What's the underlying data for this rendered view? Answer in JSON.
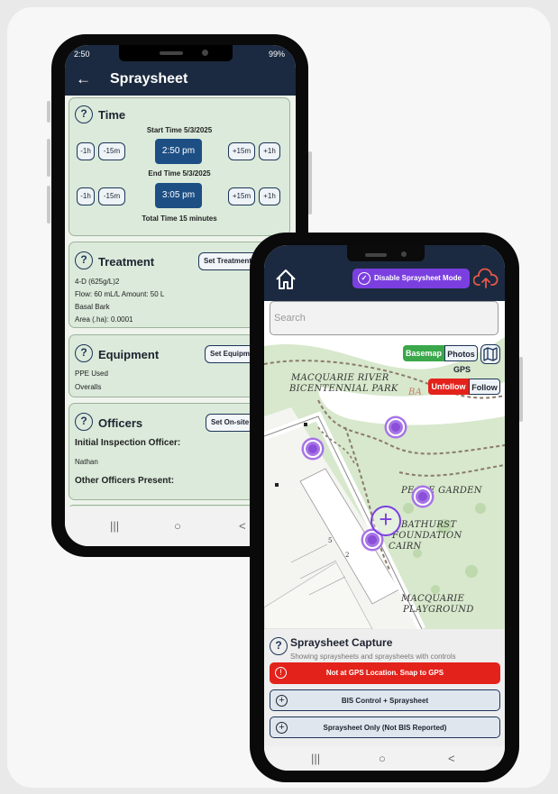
{
  "back_phone": {
    "status": {
      "time": "2:50",
      "battery": "99%"
    },
    "title": "Spraysheet",
    "time_section": {
      "title": "Time",
      "start_label": "Start Time 5/3/2025",
      "end_label": "End Time 5/3/2025",
      "start_value": "2:50 pm",
      "end_value": "3:05 pm",
      "total": "Total Time 15 minutes",
      "minus_1h": "-1h",
      "minus_15m": "-15m",
      "plus_15m": "+15m",
      "plus_1h": "+1h"
    },
    "treatment": {
      "title": "Treatment",
      "button": "Set Treatment",
      "lines": [
        "4-D (625g/L)2",
        "Flow: 60 mL/L  Amount: 50 L",
        "Basal Bark",
        "Area (.ha): 0.0001"
      ]
    },
    "equipment": {
      "title": "Equipment",
      "button": "Set Equipment",
      "lines": [
        "PPE Used",
        "Overalls"
      ]
    },
    "officers": {
      "title": "Officers",
      "button": "Set On-site",
      "initial_label": "Initial Inspection Officer:",
      "initial_value": "Nathan",
      "other_label": "Other Officers Present:"
    },
    "nav": {
      "recent": "|||",
      "home": "○",
      "back": "<"
    }
  },
  "front_phone": {
    "disable_button": "Disable Spraysheet Mode",
    "search_placeholder": "Search",
    "basemap": "Basemap",
    "photos": "Photos",
    "gps_label": "GPS",
    "unfollow": "Unfollow",
    "follow": "Follow",
    "map_labels": {
      "park1": "MACQUARIE RIVER",
      "park2": "BICENTENNIAL PARK",
      "bay": "BA",
      "peace": "PEACE GARDEN",
      "bathurst1": "BATHURST",
      "bathurst2": "FOUNDATION",
      "bathurst3": "CAIRN",
      "play1": "MACQUARIE",
      "play2": "PLAYGROUND",
      "street1": "5",
      "street2": "2"
    },
    "capture": {
      "title": "Spraysheet Capture",
      "subtitle": "Showing spraysheets and spraysheets with controls",
      "alert": "Not at GPS Location. Snap to GPS",
      "option1": "BIS Control + Spraysheet",
      "option2": "Spraysheet Only (Not BIS Reported)"
    },
    "nav": {
      "recent": "|||",
      "home": "○",
      "back": "<"
    },
    "colors": {
      "accent": "#7b3fe0",
      "alert": "#e3231b",
      "basemap": "#3aa84a",
      "appbar": "#1b2a40"
    }
  }
}
